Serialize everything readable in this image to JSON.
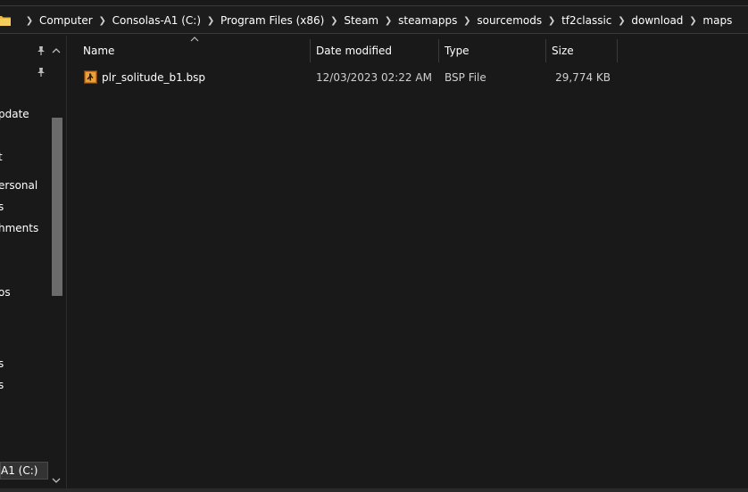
{
  "address_bar": {
    "folder_icon": "folder-icon",
    "separator_icon": "chevron-right-icon",
    "crumbs": [
      "Computer",
      "Consolas-A1 (C:)",
      "Program Files (x86)",
      "Steam",
      "steamapps",
      "sourcemods",
      "tf2classic",
      "download",
      "maps"
    ]
  },
  "nav_pane": {
    "pin_icon": "pin-icon",
    "items": [
      "pdate",
      "t",
      "ersonal",
      "s",
      "hments",
      "os",
      "s",
      "s"
    ],
    "selected_drive": "A1 (C:)"
  },
  "columns": {
    "name": "Name",
    "date_modified": "Date modified",
    "type": "Type",
    "size": "Size",
    "sort_indicator": "sort-up-icon"
  },
  "files": [
    {
      "name": "plr_solitude_b1.bsp",
      "date_modified": "12/03/2023 02:22 AM",
      "type": "BSP File",
      "size": "29,774 KB",
      "icon": "bsp-file-icon"
    }
  ],
  "colors": {
    "background": "#191919",
    "text": "#ffffff",
    "selection": "#333333",
    "scroll_thumb": "#6b6b6b"
  }
}
